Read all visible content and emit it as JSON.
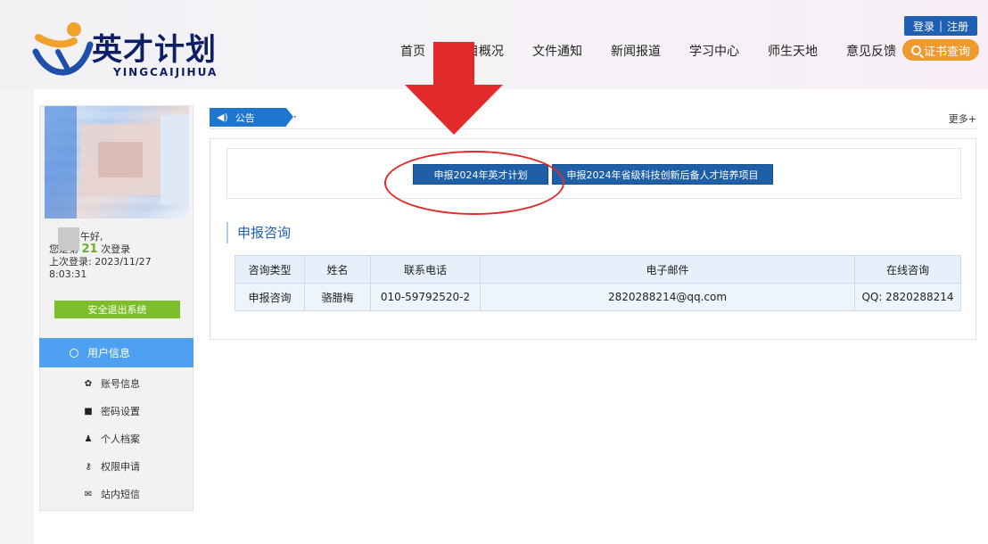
{
  "header": {
    "logo_cn": "英才计划",
    "logo_en": "YINGCAIJIHUA",
    "nav": [
      "首页",
      "项目概况",
      "文件通知",
      "新闻报道",
      "学习中心",
      "师生天地",
      "意见反馈"
    ],
    "login": "登录",
    "register": "注册",
    "cert_query": "证书查询"
  },
  "sidebar": {
    "greeting": "上午好,",
    "login_count_prefix": "您是第",
    "login_count": "21",
    "login_count_suffix": "次登录",
    "last_login_label": "上次登录:",
    "last_login_date": "2023/11/27",
    "last_login_time": "8:03:31",
    "logout": "安全退出系统",
    "menu_title": "用户信息",
    "menu": [
      {
        "icon": "gear-icon",
        "label": "账号信息"
      },
      {
        "icon": "lock-icon",
        "label": "密码设置"
      },
      {
        "icon": "person-icon",
        "label": "个人档案"
      },
      {
        "icon": "key-icon",
        "label": "权限申请"
      },
      {
        "icon": "envelope-icon",
        "label": "站内短信"
      }
    ]
  },
  "notice": {
    "tag": "公告",
    "text": "·",
    "more": "更多+"
  },
  "content": {
    "apply_btn_1": "申报2024年英才计划",
    "apply_btn_2": "申报2024年省级科技创新后备人才培养项目",
    "section_title": "申报咨询",
    "table": {
      "headers": [
        "咨询类型",
        "姓名",
        "联系电话",
        "电子邮件",
        "在线咨询"
      ],
      "rows": [
        [
          "申报咨询",
          "骆腊梅",
          "010-59792520-2",
          "2820288214@qq.com",
          "QQ: 2820288214"
        ]
      ]
    }
  },
  "colors": {
    "brand_blue": "#1e5fa8",
    "accent_orange": "#ee9a2f",
    "green": "#7cbf2a",
    "menu_blue": "#4ea0f0",
    "annotation_red": "#e22a2a"
  }
}
